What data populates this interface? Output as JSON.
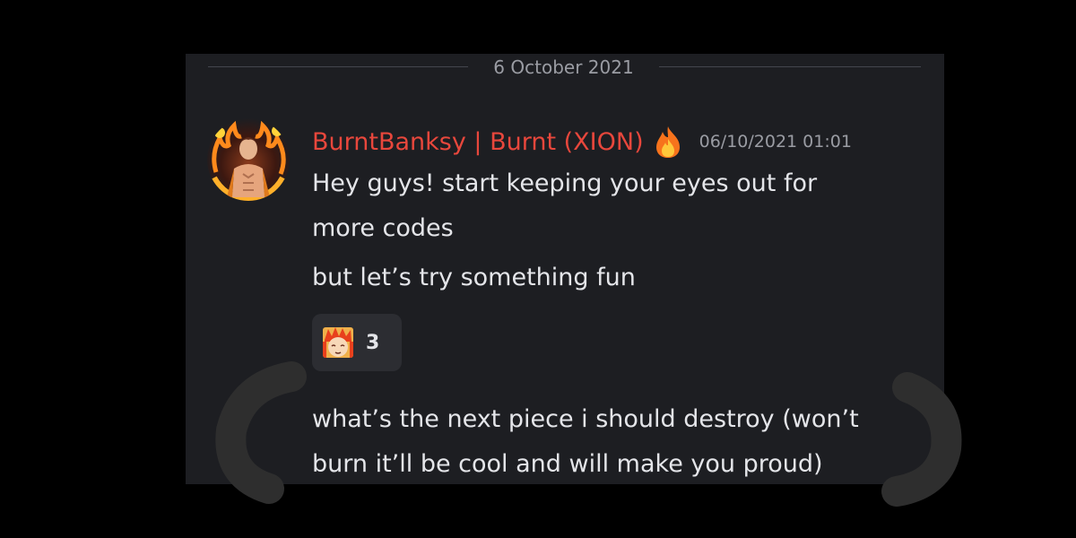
{
  "divider": {
    "date": "6 October 2021"
  },
  "message": {
    "author": "BurntBanksy | Burnt (XION)",
    "badge_icon": "fire-icon",
    "timestamp": "06/10/2021 01:01",
    "lines": [
      [
        "Hey guys! start keeping your eyes out for",
        "more codes"
      ],
      [
        "but let’s try something fun"
      ],
      [
        "what’s the next piece i should destroy (won’t",
        "burn it’ll be cool and will make you proud)"
      ]
    ]
  },
  "reaction": {
    "emoji_icon": "anime-face-emoji-icon",
    "count": "3"
  },
  "colors": {
    "background": "#000000",
    "panel": "#1d1e22",
    "username": "#e8473c",
    "text": "#e4e5e9",
    "muted": "#9a9ca3",
    "reaction_bg": "#2c2d32",
    "scribble": "#2e2e2e"
  }
}
